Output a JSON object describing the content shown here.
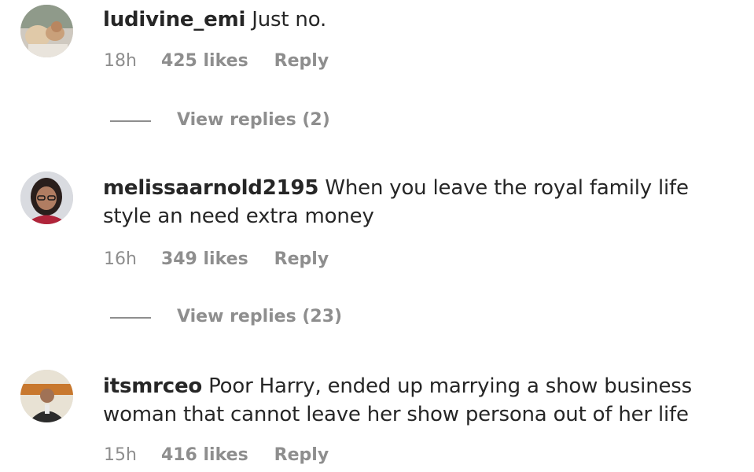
{
  "comments": [
    {
      "username": "ludivine_emi",
      "text": "Just no.",
      "time": "18h",
      "likes": "425 likes",
      "reply_label": "Reply",
      "view_replies": "View replies (2)",
      "avatar_icon": "user-avatar-photo"
    },
    {
      "username": "melissaarnold2195",
      "text": "When you leave the royal family life style an need extra money",
      "time": "16h",
      "likes": "349 likes",
      "reply_label": "Reply",
      "view_replies": "View replies (23)",
      "avatar_icon": "user-avatar-photo"
    },
    {
      "username": "itsmrceo",
      "text": "Poor Harry, ended up marrying a show business woman that cannot leave her show persona out of her life",
      "time": "15h",
      "likes": "416 likes",
      "reply_label": "Reply",
      "avatar_icon": "user-avatar-photo"
    }
  ],
  "colors": {
    "primary_text": "#262626",
    "secondary_text": "#8e8e8e",
    "background": "#ffffff"
  }
}
